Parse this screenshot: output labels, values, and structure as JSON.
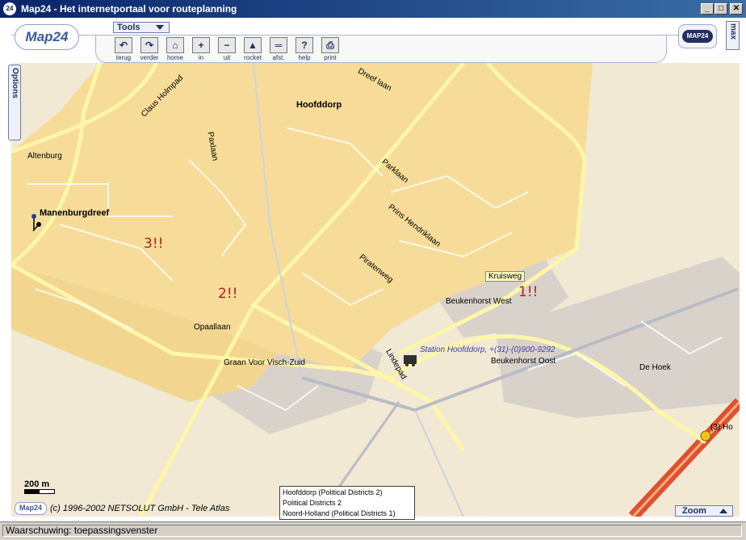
{
  "window": {
    "title": "Map24 - Het internetportaal voor routeplanning",
    "app_icon": "24"
  },
  "window_buttons": {
    "minimize": "_",
    "maximize": "□",
    "close": "✕"
  },
  "logo_text": "Map24",
  "tools_menu": "Tools",
  "toolbar": [
    {
      "label": "terug",
      "icon": "back-arrow-icon",
      "glyph": "↶"
    },
    {
      "label": "verder",
      "icon": "forward-arrow-icon",
      "glyph": "↷"
    },
    {
      "label": "home",
      "icon": "home-icon",
      "glyph": "⌂"
    },
    {
      "label": "in",
      "icon": "zoom-in-icon",
      "glyph": "+"
    },
    {
      "label": "uit",
      "icon": "zoom-out-icon",
      "glyph": "−"
    },
    {
      "label": "rocket",
      "icon": "rocket-icon",
      "glyph": "▲"
    },
    {
      "label": "afst.",
      "icon": "ruler-icon",
      "glyph": "═"
    },
    {
      "label": "help",
      "icon": "help-icon",
      "glyph": "?"
    },
    {
      "label": "print",
      "icon": "printer-icon",
      "glyph": "⎙"
    }
  ],
  "map24_button": "MAP24",
  "max_tab": "max",
  "options_tab": "Options",
  "map": {
    "places": {
      "hoofddorp": "Hoofddorp",
      "manenburgdreef": "Manenburgdreef",
      "altenburg": "Altenburg",
      "beukenhorst_west": "Beukenhorst West",
      "beukenhorst_oost": "Beukenhorst Oost",
      "de_hoek": "De Hoek",
      "graan": "Graan Voor Visch-Zuid",
      "opaallaan": "Opaallaan",
      "kruisweg": "Kruisweg"
    },
    "streets": {
      "claus": "Claus Holmpad",
      "paxlaan": "Paxlaan",
      "parklaan": "Parklaan",
      "prins": "Prins Hendriklaan",
      "piratenweg": "Piratenweg",
      "lindepad": "Lindepad",
      "dreef_top": "Dreef laan"
    },
    "districts_marks": [
      "3!!",
      "2!!",
      "1!!"
    ],
    "station": "Station Hoofddorp, +(31)-(0)900-9292",
    "exit_label": "(3) Ho"
  },
  "scale": "200 m",
  "copyright": "(c) 1996-2002 NETSOLUT GmbH - Tele Atlas",
  "copyright_logo": "Map24",
  "districts_popup": [
    "Hoofddorp (Political Districts 2)",
    "Political Districts 2",
    "Noord-Holland (Political Districts 1)"
  ],
  "zoom_button": "Zoom",
  "status": "Waarschuwing: toepassingsvenster",
  "colors": {
    "urban": "#f6dc98",
    "road": "#fff6a8",
    "industrial": "#d8d0c8",
    "highway": "#e05030",
    "titlebar": "#0a246a"
  }
}
